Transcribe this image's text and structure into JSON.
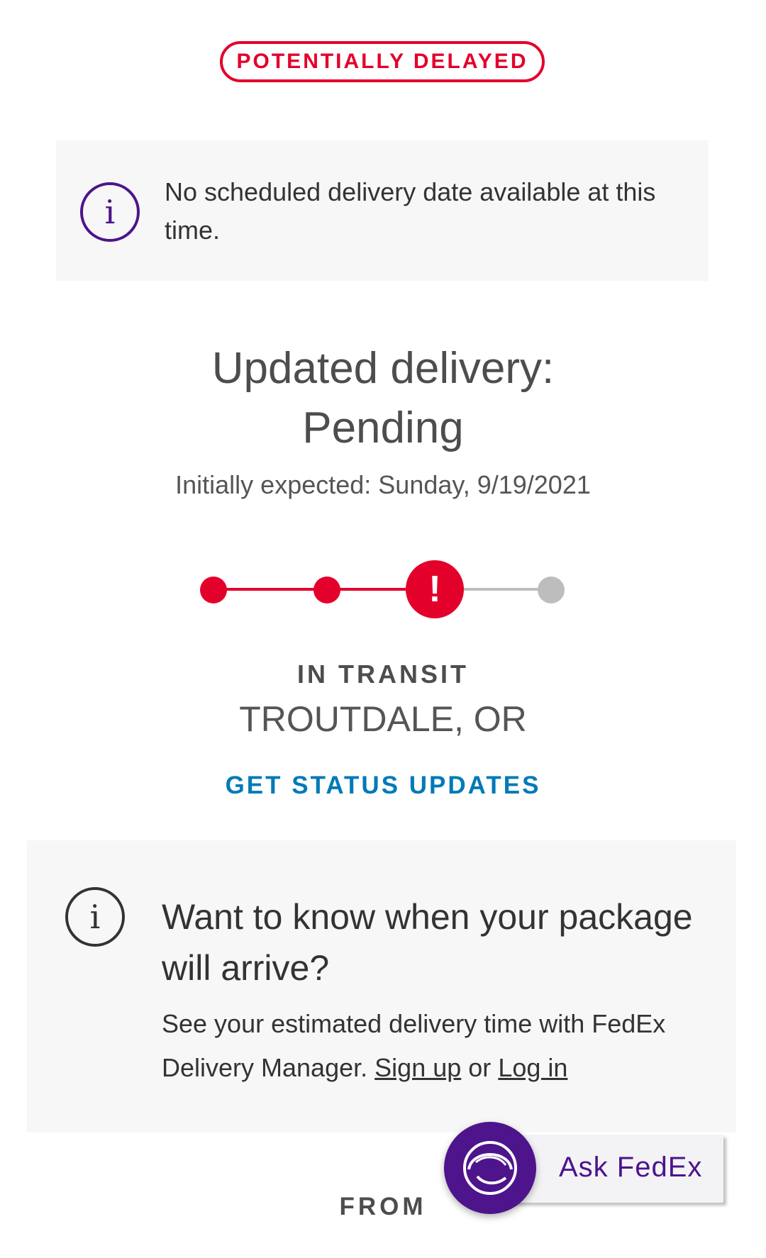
{
  "status_badge": "POTENTIALLY DELAYED",
  "notice": {
    "message": "No scheduled delivery date available at this time.",
    "icon": "info-icon"
  },
  "delivery": {
    "heading": "Updated delivery:",
    "value": "Pending",
    "initially_expected": "Initially expected: Sunday, 9/19/2021"
  },
  "progress": {
    "steps_total": 4,
    "current_step": 3,
    "current_state": "alert",
    "alert_glyph": "!"
  },
  "shipment": {
    "status": "IN TRANSIT",
    "location": "TROUTDALE, OR"
  },
  "actions": {
    "get_updates": "GET STATUS UPDATES"
  },
  "promo": {
    "title": "Want to know when your package will arrive?",
    "text": "See your estimated delivery time with FedEx Delivery Manager.",
    "signup_label": "Sign up",
    "or_text": "or",
    "login_label": "Log in"
  },
  "from_label": "FROM",
  "chat": {
    "label": "Ask FedEx",
    "icon": "headset-agent-icon"
  },
  "colors": {
    "alert_red": "#e3002b",
    "fedex_purple": "#4d148c",
    "link_blue": "#007ab7",
    "inactive_gray": "#bdbdbd"
  }
}
